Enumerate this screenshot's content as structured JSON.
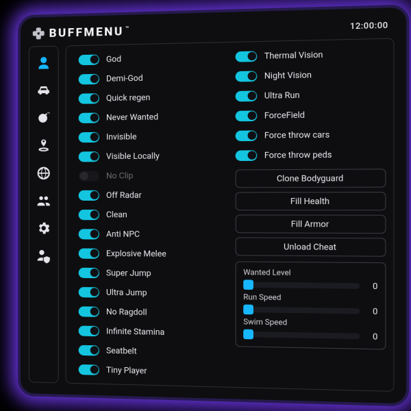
{
  "brand": {
    "name": "BUFFMENU",
    "tm": "™"
  },
  "clock": "12:00:00",
  "sidebar": [
    {
      "name": "player",
      "active": true
    },
    {
      "name": "vehicle",
      "active": false
    },
    {
      "name": "weapon",
      "active": false
    },
    {
      "name": "teleport",
      "active": false
    },
    {
      "name": "online",
      "active": false
    },
    {
      "name": "lobby",
      "active": false
    },
    {
      "name": "settings",
      "active": false
    },
    {
      "name": "protection",
      "active": false
    }
  ],
  "toggles_left": [
    {
      "label": "God",
      "on": true,
      "disabled": false
    },
    {
      "label": "Demi-God",
      "on": true,
      "disabled": false
    },
    {
      "label": "Quick regen",
      "on": true,
      "disabled": false
    },
    {
      "label": "Never Wanted",
      "on": true,
      "disabled": false
    },
    {
      "label": "Invisible",
      "on": true,
      "disabled": false
    },
    {
      "label": "Visible Locally",
      "on": true,
      "disabled": false
    },
    {
      "label": "No Clip",
      "on": false,
      "disabled": true
    },
    {
      "label": "Off Radar",
      "on": true,
      "disabled": false
    },
    {
      "label": "Clean",
      "on": true,
      "disabled": false
    },
    {
      "label": "Anti NPC",
      "on": true,
      "disabled": false
    },
    {
      "label": "Explosive Melee",
      "on": true,
      "disabled": false
    },
    {
      "label": "Super Jump",
      "on": true,
      "disabled": false
    },
    {
      "label": "Ultra Jump",
      "on": true,
      "disabled": false
    },
    {
      "label": "No Ragdoll",
      "on": true,
      "disabled": false
    },
    {
      "label": "Infinite Stamina",
      "on": true,
      "disabled": false
    },
    {
      "label": "Seatbelt",
      "on": true,
      "disabled": false
    },
    {
      "label": "Tiny Player",
      "on": true,
      "disabled": false
    }
  ],
  "toggles_right": [
    {
      "label": "Thermal Vision",
      "on": true
    },
    {
      "label": "Night Vision",
      "on": true
    },
    {
      "label": "Ultra Run",
      "on": true
    },
    {
      "label": "ForceField",
      "on": true
    },
    {
      "label": "Force throw cars",
      "on": true
    },
    {
      "label": "Force throw peds",
      "on": true
    }
  ],
  "buttons": [
    "Clone Bodyguard",
    "Fill Health",
    "Fill Armor",
    "Unload Cheat"
  ],
  "sliders": [
    {
      "label": "Wanted Level",
      "value": 0
    },
    {
      "label": "Run Speed",
      "value": 0
    },
    {
      "label": "Swim Speed",
      "value": 0
    }
  ],
  "colors": {
    "accent": "#17b7ff",
    "toggle_on": "#14c5e0",
    "glow": "#7b3cff"
  }
}
